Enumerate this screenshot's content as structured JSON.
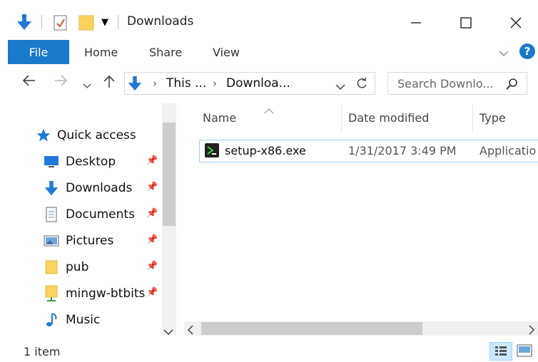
{
  "window": {
    "title": "Downloads"
  },
  "ribbon": {
    "file": "File",
    "tabs": [
      "Home",
      "Share",
      "View"
    ]
  },
  "nav": {
    "breadcrumb": [
      "This ...",
      "Downloa..."
    ],
    "search_placeholder": "Search Downlo..."
  },
  "sidebar": {
    "quick_access": "Quick access",
    "items": [
      {
        "label": "Desktop",
        "icon": "desktop-icon",
        "pinned": true
      },
      {
        "label": "Downloads",
        "icon": "download-arrow-icon",
        "pinned": true
      },
      {
        "label": "Documents",
        "icon": "documents-icon",
        "pinned": true
      },
      {
        "label": "Pictures",
        "icon": "pictures-icon",
        "pinned": true
      },
      {
        "label": "pub",
        "icon": "folder-icon",
        "pinned": true
      },
      {
        "label": "mingw-btbits",
        "icon": "network-folder-icon",
        "pinned": true
      },
      {
        "label": "Music",
        "icon": "music-icon",
        "pinned": false
      }
    ]
  },
  "columns": [
    "Name",
    "Date modified",
    "Type"
  ],
  "files": [
    {
      "name": "setup-x86.exe",
      "date": "1/31/2017 3:49 PM",
      "type": "Applicatio"
    }
  ],
  "status": {
    "items": "1 item"
  },
  "colors": {
    "accent": "#1979ca",
    "selection_border": "#99d1ff"
  }
}
